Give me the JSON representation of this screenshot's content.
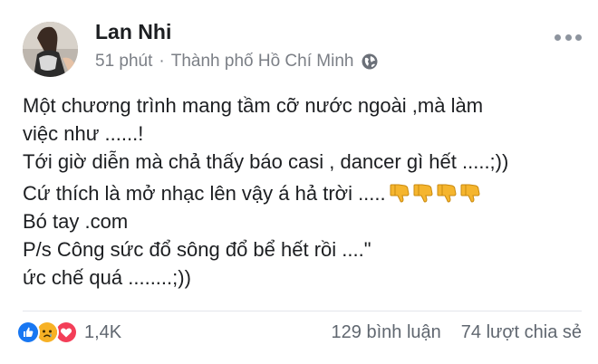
{
  "post": {
    "author": "Lan Nhi",
    "time": "51 phút",
    "separator": "·",
    "location": "Thành phố Hồ Chí Minh",
    "content": {
      "line1": "Một chương trình mang tầm cỡ nước ngoài ,mà làm",
      "line2": "việc như ......!",
      "line3": "Tới giờ diễn mà chả thấy báo casi , dancer gì hết .....;))",
      "line4": "Cứ thích là mở nhạc lên vậy á hả trời .....",
      "line5": "Bó tay .com",
      "line6": "P/s Công sức đổ sông đổ bể hết rồi ....\"",
      "line7": "ức chế quá ........;))"
    },
    "emoji": "thumbs-down",
    "emoji_count": 4
  },
  "reactions": {
    "types": [
      "like",
      "sad",
      "love"
    ],
    "count": "1,4K"
  },
  "stats": {
    "comments": "129 bình luận",
    "shares": "74 lượt chia sẻ"
  },
  "colors": {
    "like": "#1877f2",
    "love": "#f33e58",
    "sad": "#f7b125",
    "muted_text": "#606770"
  },
  "icons": {
    "more": "more-icon",
    "globe": "globe-icon"
  }
}
